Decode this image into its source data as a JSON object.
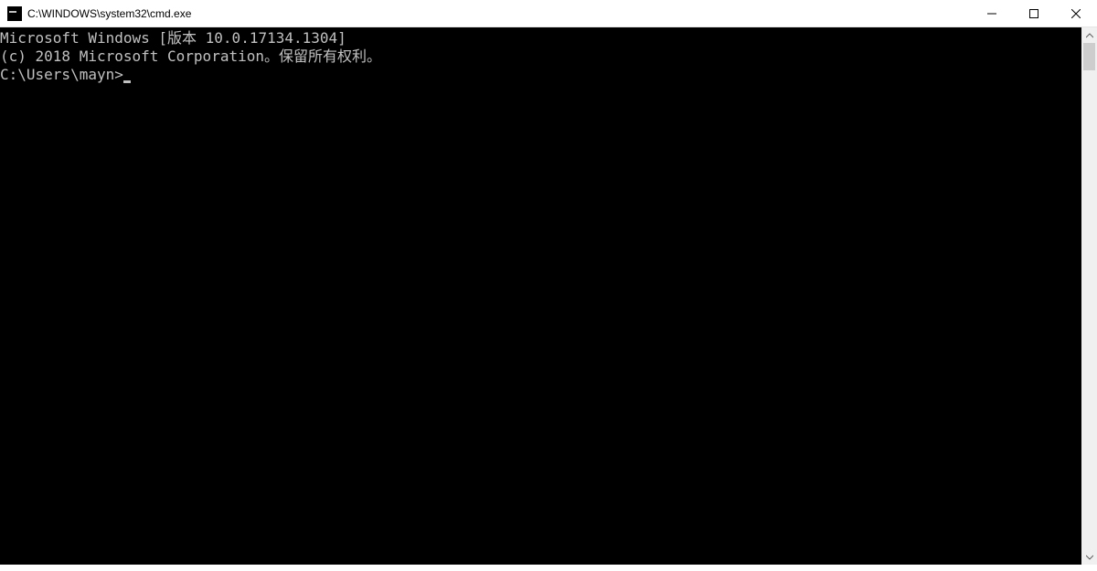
{
  "window": {
    "title": "C:\\WINDOWS\\system32\\cmd.exe"
  },
  "terminal": {
    "line1": "Microsoft Windows [版本 10.0.17134.1304]",
    "line2": "(c) 2018 Microsoft Corporation。保留所有权利。",
    "blank": "",
    "prompt": "C:\\Users\\mayn>"
  }
}
